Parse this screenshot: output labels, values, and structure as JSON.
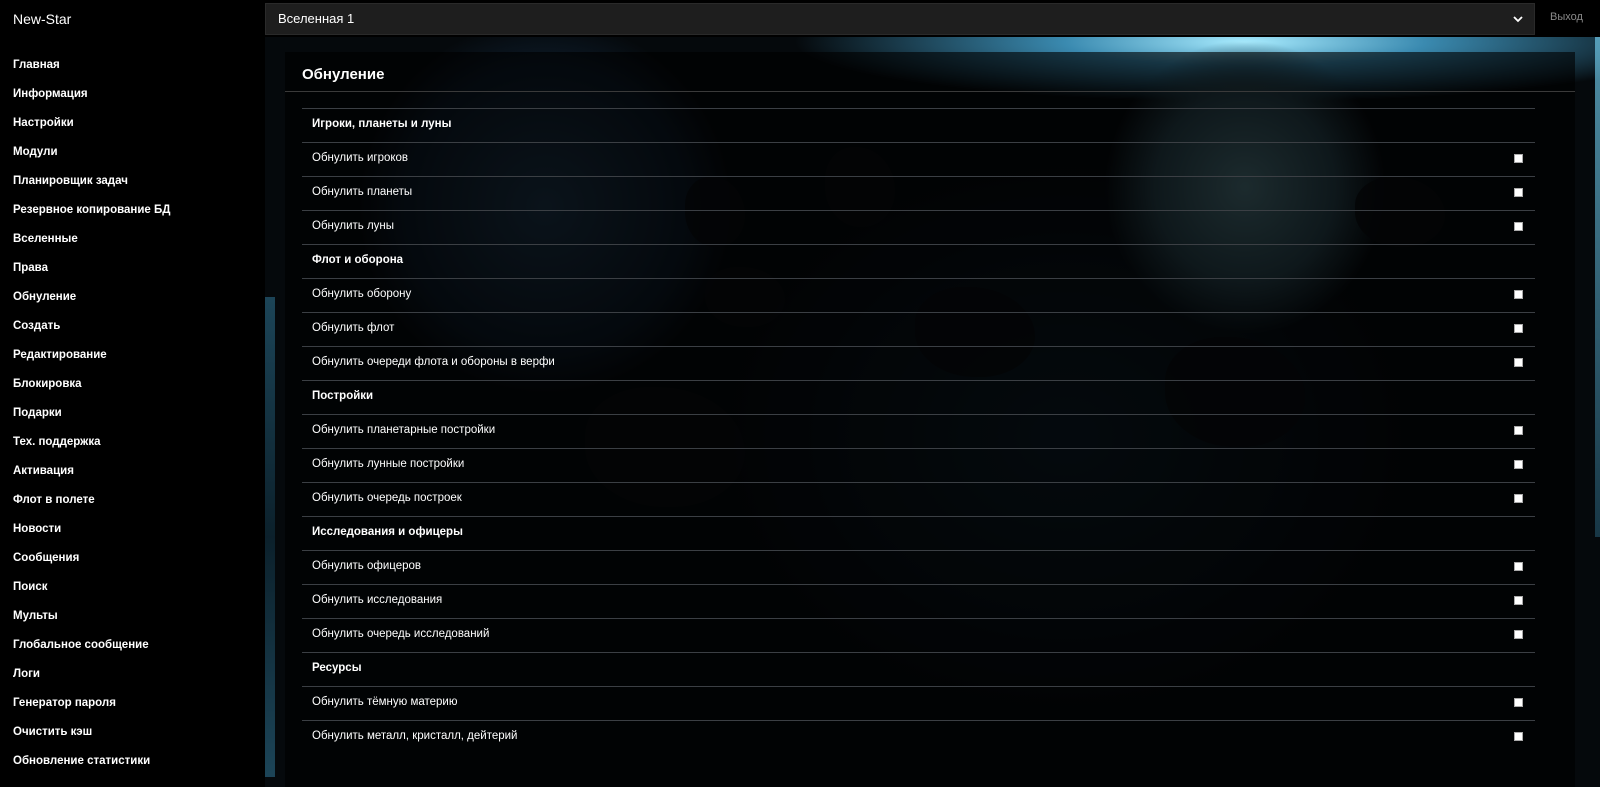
{
  "sidebar": {
    "brand": "New-Star",
    "items": [
      {
        "label": "Главная"
      },
      {
        "label": "Информация"
      },
      {
        "label": "Настройки"
      },
      {
        "label": "Модули"
      },
      {
        "label": "Планировщик задач"
      },
      {
        "label": "Резервное копирование БД"
      },
      {
        "label": "Вселенные"
      },
      {
        "label": "Права"
      },
      {
        "label": "Обнуление"
      },
      {
        "label": "Создать"
      },
      {
        "label": "Редактирование"
      },
      {
        "label": "Блокировка"
      },
      {
        "label": "Подарки"
      },
      {
        "label": "Тех. поддержка"
      },
      {
        "label": "Активация"
      },
      {
        "label": "Флот в полете"
      },
      {
        "label": "Новости"
      },
      {
        "label": "Сообщения"
      },
      {
        "label": "Поиск"
      },
      {
        "label": "Мульты"
      },
      {
        "label": "Глобальное сообщение"
      },
      {
        "label": "Логи"
      },
      {
        "label": "Генератор пароля"
      },
      {
        "label": "Очистить кэш"
      },
      {
        "label": "Обновление статистики"
      }
    ]
  },
  "topbar": {
    "universe_selected": "Вселенная 1",
    "logout_label": "Выход"
  },
  "panel": {
    "title": "Обнуление",
    "rows": [
      {
        "type": "head",
        "label": "Игроки, планеты и луны"
      },
      {
        "type": "option",
        "label": "Обнулить игроков",
        "checked": false
      },
      {
        "type": "option",
        "label": "Обнулить планеты",
        "checked": false
      },
      {
        "type": "option",
        "label": "Обнулить луны",
        "checked": false
      },
      {
        "type": "head",
        "label": "Флот и оборона"
      },
      {
        "type": "option",
        "label": "Обнулить оборону",
        "checked": false
      },
      {
        "type": "option",
        "label": "Обнулить флот",
        "checked": false
      },
      {
        "type": "option",
        "label": "Обнулить очереди флота и обороны в верфи",
        "checked": false
      },
      {
        "type": "head",
        "label": "Постройки"
      },
      {
        "type": "option",
        "label": "Обнулить планетарные постройки",
        "checked": false
      },
      {
        "type": "option",
        "label": "Обнулить лунные постройки",
        "checked": false
      },
      {
        "type": "option",
        "label": "Обнулить очередь построек",
        "checked": false
      },
      {
        "type": "head",
        "label": "Исследования и офицеры"
      },
      {
        "type": "option",
        "label": "Обнулить офицеров",
        "checked": false
      },
      {
        "type": "option",
        "label": "Обнулить исследования",
        "checked": false
      },
      {
        "type": "option",
        "label": "Обнулить очередь исследований",
        "checked": false
      },
      {
        "type": "head",
        "label": "Ресурсы"
      },
      {
        "type": "option",
        "label": "Обнулить тёмную материю",
        "checked": false
      },
      {
        "type": "option",
        "label": "Обнулить металл, кристалл, дейтерий",
        "checked": false
      }
    ]
  },
  "icons": {
    "select_chevron": "chevron-down-icon"
  },
  "colors": {
    "sidebar_bg": "#000000",
    "select_bg": "#1e1e1e",
    "row_border": "#3b3f44",
    "logout_text": "#8a8a8a"
  }
}
